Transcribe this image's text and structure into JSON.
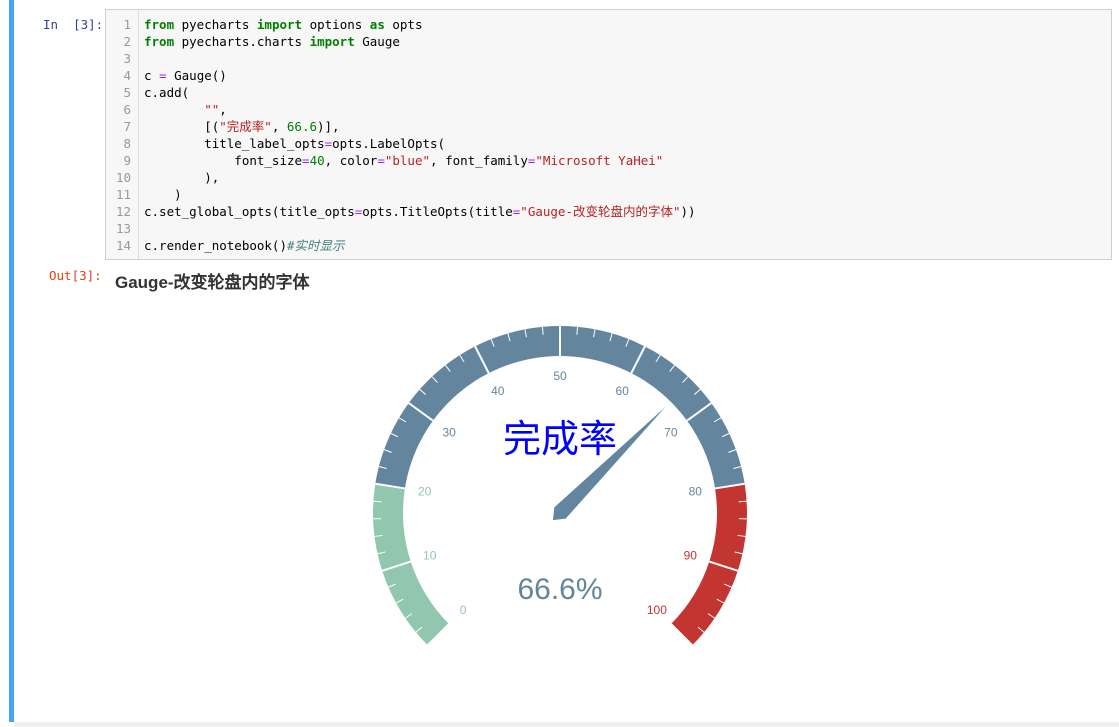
{
  "cell": {
    "in_prompt": "In  [3]:",
    "out_prompt": "Out[3]:"
  },
  "code_lines": [
    {
      "num": "1",
      "tokens": [
        {
          "t": "from",
          "c": "kw"
        },
        {
          "t": " pyecharts ",
          "c": ""
        },
        {
          "t": "import",
          "c": "kw"
        },
        {
          "t": " options ",
          "c": ""
        },
        {
          "t": "as",
          "c": "kw"
        },
        {
          "t": " opts",
          "c": ""
        }
      ]
    },
    {
      "num": "2",
      "tokens": [
        {
          "t": "from",
          "c": "kw"
        },
        {
          "t": " pyecharts.charts ",
          "c": ""
        },
        {
          "t": "import",
          "c": "kw"
        },
        {
          "t": " Gauge",
          "c": ""
        }
      ]
    },
    {
      "num": "3",
      "tokens": []
    },
    {
      "num": "4",
      "tokens": [
        {
          "t": "c ",
          "c": ""
        },
        {
          "t": "=",
          "c": "op"
        },
        {
          "t": " Gauge()",
          "c": ""
        }
      ]
    },
    {
      "num": "5",
      "tokens": [
        {
          "t": "c.add(",
          "c": ""
        }
      ]
    },
    {
      "num": "6",
      "tokens": [
        {
          "t": "        ",
          "c": ""
        },
        {
          "t": "\"\"",
          "c": "str"
        },
        {
          "t": ",",
          "c": ""
        }
      ]
    },
    {
      "num": "7",
      "tokens": [
        {
          "t": "        [(",
          "c": ""
        },
        {
          "t": "\"完成率\"",
          "c": "str"
        },
        {
          "t": ", ",
          "c": ""
        },
        {
          "t": "66.6",
          "c": "num"
        },
        {
          "t": ")],",
          "c": ""
        }
      ]
    },
    {
      "num": "8",
      "tokens": [
        {
          "t": "        title_label_opts",
          "c": ""
        },
        {
          "t": "=",
          "c": "op"
        },
        {
          "t": "opts.LabelOpts(",
          "c": ""
        }
      ]
    },
    {
      "num": "9",
      "tokens": [
        {
          "t": "            font_size",
          "c": ""
        },
        {
          "t": "=",
          "c": "op"
        },
        {
          "t": "40",
          "c": "num"
        },
        {
          "t": ", color",
          "c": ""
        },
        {
          "t": "=",
          "c": "op"
        },
        {
          "t": "\"blue\"",
          "c": "str"
        },
        {
          "t": ", font_family",
          "c": ""
        },
        {
          "t": "=",
          "c": "op"
        },
        {
          "t": "\"Microsoft YaHei\"",
          "c": "str"
        }
      ]
    },
    {
      "num": "10",
      "tokens": [
        {
          "t": "        ),",
          "c": ""
        }
      ]
    },
    {
      "num": "11",
      "tokens": [
        {
          "t": "    )",
          "c": ""
        }
      ]
    },
    {
      "num": "12",
      "tokens": [
        {
          "t": "c.set_global_opts(title_opts",
          "c": ""
        },
        {
          "t": "=",
          "c": "op"
        },
        {
          "t": "opts.TitleOpts(title",
          "c": ""
        },
        {
          "t": "=",
          "c": "op"
        },
        {
          "t": "\"Gauge-改变轮盘内的字体\"",
          "c": "str"
        },
        {
          "t": "))",
          "c": ""
        }
      ]
    },
    {
      "num": "13",
      "tokens": []
    },
    {
      "num": "14",
      "tokens": [
        {
          "t": "c.render_notebook()",
          "c": ""
        },
        {
          "t": "#实时显示",
          "c": "cm"
        }
      ]
    }
  ],
  "chart_data": {
    "type": "gauge",
    "title": "Gauge-改变轮盘内的字体",
    "series_name": "完成率",
    "value": 66.6,
    "detail": "66.6%",
    "min": 0,
    "max": 100,
    "ticks": [
      "0",
      "10",
      "20",
      "30",
      "40",
      "50",
      "60",
      "70",
      "80",
      "90",
      "100"
    ],
    "bands": [
      {
        "to": 0.2,
        "color": "#91c7ae"
      },
      {
        "to": 0.8,
        "color": "#63869e"
      },
      {
        "to": 1.0,
        "color": "#c23531"
      }
    ],
    "title_color": "blue",
    "pointer_color": "#63869e"
  }
}
